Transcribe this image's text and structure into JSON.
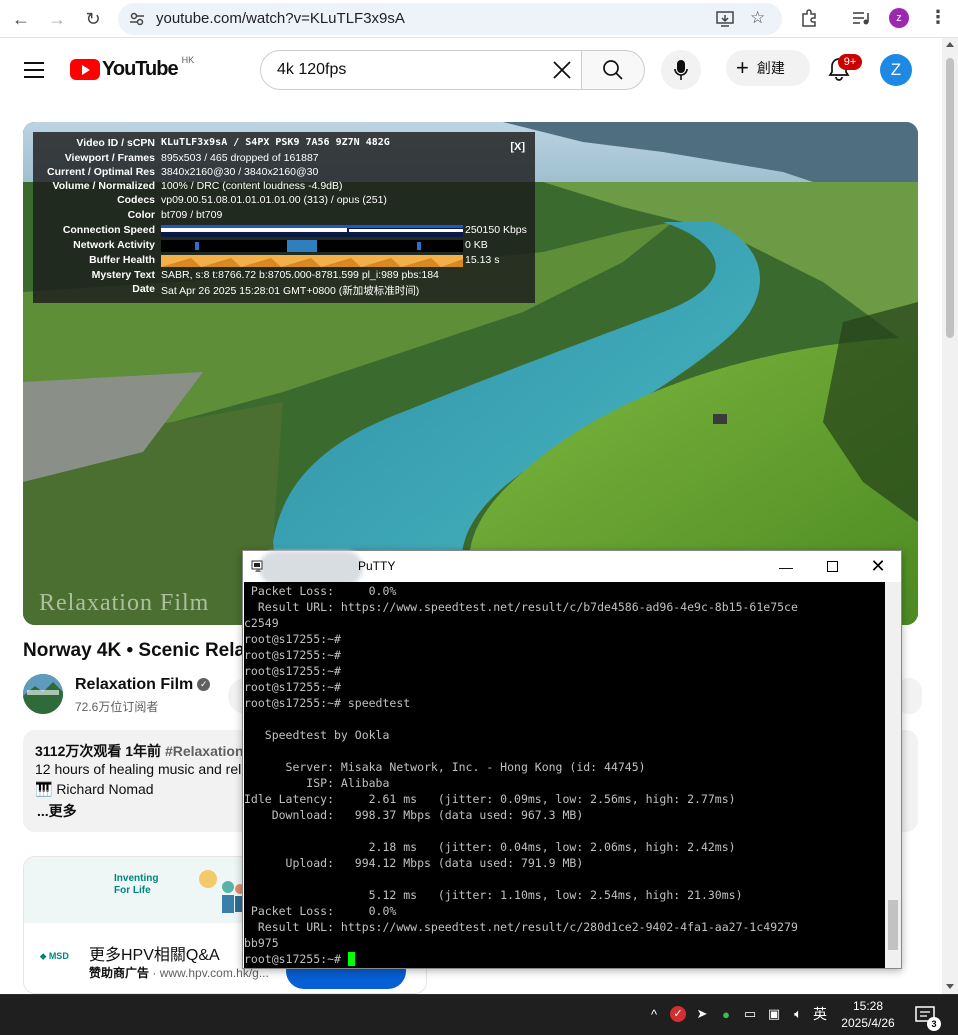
{
  "browser": {
    "url": "youtube.com/watch?v=KLuTLF3x9sA",
    "profile_initial": "z"
  },
  "header": {
    "logo_text": "YouTube",
    "region": "HK",
    "search_query": "4k 120fps",
    "create_label": "創建",
    "notification_count": "9+",
    "account_initial": "Z"
  },
  "stats": {
    "rows": [
      {
        "label": "Video ID / sCPN",
        "value": "KLuTLF3x9sA / S4PX PSK9 7A56 9Z7N 482G",
        "mono": true
      },
      {
        "label": "Viewport / Frames",
        "value": "895x503 / 465 dropped of 161887"
      },
      {
        "label": "Current / Optimal Res",
        "value": "3840x2160@30 / 3840x2160@30"
      },
      {
        "label": "Volume / Normalized",
        "value": "100% / DRC (content loudness -4.9dB)"
      },
      {
        "label": "Codecs",
        "value": "vp09.00.51.08.01.01.01.01.00 (313) / opus (251)"
      },
      {
        "label": "Color",
        "value": "bt709 / bt709"
      },
      {
        "label": "Connection Speed",
        "value": "250150 Kbps"
      },
      {
        "label": "Network Activity",
        "value": "0 KB"
      },
      {
        "label": "Buffer Health",
        "value": "15.13 s"
      },
      {
        "label": "Mystery Text",
        "value": "SABR, s:8 t:8766.72 b:8705.000-8781.599 pl_i:989 pbs:184"
      },
      {
        "label": "Date",
        "value": "Sat Apr 26 2025 15:28:01 GMT+0800 (新加坡标准时间)"
      }
    ],
    "close_label": "[X]"
  },
  "video": {
    "watermark": "Relaxation Film",
    "title": "Norway 4K • Scenic Rela",
    "channel_name": "Relaxation Film",
    "subscribers": "72.6万位订阅者",
    "views_date": "3112万次观看  1年前",
    "hashtag": "#Relaxation",
    "desc_line1": "12 hours of healing music and rel",
    "desc_line2": "🎹 Richard Nomad",
    "more_label": "...更多"
  },
  "ad": {
    "banner_text": "Inventing For Life",
    "advertiser_logo": "MSD",
    "title": "更多HPV相關Q&A",
    "sponsor_label": "赞助商广告",
    "domain": "www.hpv.com.hk/g..."
  },
  "putty": {
    "title": "PuTTY",
    "terminal_lines": [
      " Packet Loss:     0.0%",
      "  Result URL: https://www.speedtest.net/result/c/b7de4586-ad96-4e9c-8b15-61e75ce",
      "c2549",
      "root@s17255:~#",
      "root@s17255:~#",
      "root@s17255:~#",
      "root@s17255:~#",
      "root@s17255:~# speedtest",
      "",
      "   Speedtest by Ookla",
      "",
      "      Server: Misaka Network, Inc. - Hong Kong (id: 44745)",
      "         ISP: Alibaba",
      "Idle Latency:     2.61 ms   (jitter: 0.09ms, low: 2.56ms, high: 2.77ms)",
      "    Download:   998.37 Mbps (data used: 967.3 MB)",
      "",
      "                  2.18 ms   (jitter: 0.04ms, low: 2.06ms, high: 2.42ms)",
      "      Upload:   994.12 Mbps (data used: 791.9 MB)",
      "",
      "                  5.12 ms   (jitter: 1.10ms, low: 2.54ms, high: 21.30ms)",
      " Packet Loss:     0.0%",
      "  Result URL: https://www.speedtest.net/result/c/280d1ce2-9402-4fa1-aa27-1c49279",
      "bb975",
      "root@s17255:~# "
    ]
  },
  "taskbar": {
    "ime": "英",
    "time": "15:28",
    "date": "2025/4/26",
    "notification_count": "3"
  }
}
